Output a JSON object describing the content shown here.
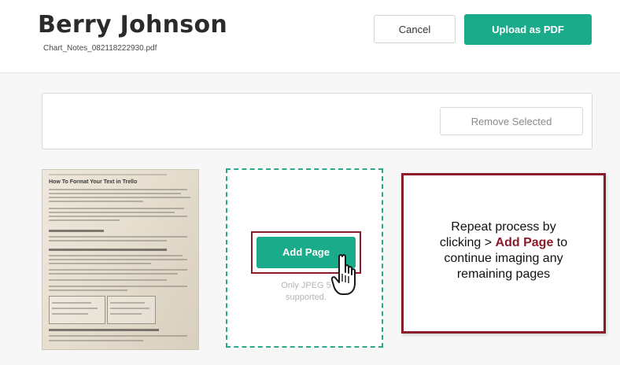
{
  "header": {
    "patient_name": "Berry Johnson",
    "file_name": "Chart_Notes_082118222930.pdf",
    "cancel_label": "Cancel",
    "upload_label": "Upload as PDF"
  },
  "selection": {
    "remove_label": "Remove Selected"
  },
  "thumbnail": {
    "heading": "How To Format Your Text in Trello"
  },
  "add_page": {
    "button_label": "Add Page",
    "note_line1": "Only JPEG 5",
    "note_line2": "supported."
  },
  "callout": {
    "line1": "Repeat process by",
    "line2_prefix": "clicking > ",
    "line2_accent": "Add Page",
    "line2_suffix": " to",
    "line3": "continue imaging any",
    "line4": "remaining pages"
  },
  "colors": {
    "accent_green": "#1aab8a",
    "highlight_red": "#8b1a2b"
  },
  "icons": {
    "cursor": "hand-pointer-icon"
  }
}
